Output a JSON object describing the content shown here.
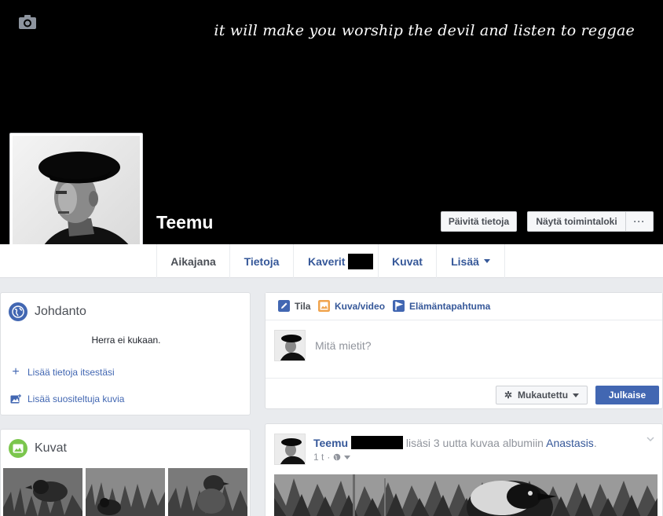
{
  "cover": {
    "quote": "it will make you worship the devil and listen to reggae",
    "camera_icon": "camera-icon"
  },
  "profile": {
    "name": "Teemu",
    "buttons": {
      "update_info": "Päivitä tietoja",
      "activity_log": "Näytä toimintaloki",
      "more": "···"
    }
  },
  "nav": {
    "tabs": [
      {
        "label": "Aikajana",
        "active": true
      },
      {
        "label": "Tietoja"
      },
      {
        "label": "Kaverit"
      },
      {
        "label": "Kuvat"
      },
      {
        "label": "Lisää"
      }
    ]
  },
  "intro": {
    "title": "Johdanto",
    "bio": "Herra ei kukaan.",
    "links": [
      {
        "label": "Lisää tietoja itsestäsi",
        "icon": "plus-icon"
      },
      {
        "label": "Lisää suositeltuja kuvia",
        "icon": "photo-add-icon"
      }
    ]
  },
  "photos": {
    "title": "Kuvat"
  },
  "composer": {
    "tabs": [
      {
        "label": "Tila",
        "icon": "pencil-icon"
      },
      {
        "label": "Kuva/video",
        "icon": "photo-icon"
      },
      {
        "label": "Elämäntapahtuma",
        "icon": "flag-icon"
      }
    ],
    "placeholder": "Mitä mietit?",
    "audience": "Mukautettu",
    "post_button": "Julkaise"
  },
  "post": {
    "author": "Teemu",
    "action": "lisäsi 3 uutta kuvaa albumiin",
    "album": "Anastasis",
    "period": ".",
    "time": "1 t",
    "privacy_icon": "globe-icon"
  },
  "colors": {
    "accent": "#4267b2",
    "link": "#365899",
    "page_bg": "#e9ebee"
  }
}
